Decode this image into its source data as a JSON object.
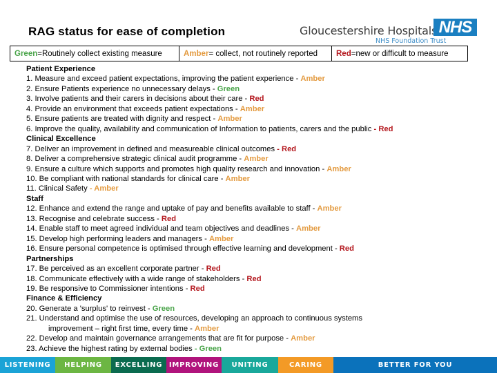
{
  "title": "RAG status for ease of completion",
  "logo": {
    "org_name": "Gloucestershire Hospitals",
    "nhs_mark": "NHS",
    "subtitle": "NHS Foundation Trust"
  },
  "colors": {
    "green": "#4aa44a",
    "amber": "#e39a3f",
    "red": "#b3161c",
    "nhs_blue": "#1a7fc1"
  },
  "legend": [
    {
      "status": "Green",
      "text": " =Routinely collect existing measure"
    },
    {
      "status": "Amber",
      "text": " = collect, not routinely reported"
    },
    {
      "status": "Red",
      "text": " =new or difficult to measure"
    }
  ],
  "sections": [
    {
      "heading": "Patient Experience",
      "items": [
        {
          "text": "1. Measure and exceed patient expectations, improving the patient experience - ",
          "status": "Amber"
        },
        {
          "text": "2. Ensure Patients experience no unnecessary delays - ",
          "status": "Green"
        },
        {
          "text": "3. Involve patients and their carers in decisions about their care - ",
          "status": "Red"
        },
        {
          "text": "4. Provide an environment that exceeds patient expectations - ",
          "status": "Amber"
        },
        {
          "text": "5. Ensure patients are treated with dignity and respect - ",
          "status": "Amber"
        },
        {
          "text": "6. Improve the quality, availability and communication of Information to patients, carers and the public ",
          "status": "- Red"
        }
      ]
    },
    {
      "heading": "Clinical Excellence",
      "items": [
        {
          "text": "7. Deliver an improvement in defined and measureable clinical outcomes ",
          "status": "- Red"
        },
        {
          "text": "8. Deliver a comprehensive strategic clinical audit programme - ",
          "status": "Amber"
        },
        {
          "text": "9. Ensure a culture which supports and promotes high quality research and innovation - ",
          "status": "Amber"
        },
        {
          "text": "10. Be compliant with national standards for clinical care - ",
          "status": "Amber"
        },
        {
          "text": "11. Clinical Safety ",
          "status": "- Amber"
        }
      ]
    },
    {
      "heading": "Staff",
      "items": [
        {
          "text": "12. Enhance and extend the range and uptake of pay and benefits available to staff - ",
          "status": "Amber"
        },
        {
          "text": "13. Recognise and celebrate success - ",
          "status": "Red"
        },
        {
          "text": "14. Enable staff to meet agreed individual and team objectives and deadlines - ",
          "status": "Amber"
        },
        {
          "text": "15. Develop high performing leaders and managers - ",
          "status": "Amber"
        },
        {
          "text": "16. Ensure personal competence is optimised through effective learning and development - ",
          "status": "Red"
        }
      ]
    },
    {
      "heading": "Partnerships",
      "items": [
        {
          "text": "17. Be perceived as an excellent corporate partner - ",
          "status": "Red"
        },
        {
          "text": "18. Communicate effectively with a wide range of stakeholders - ",
          "status": "Red"
        },
        {
          "text": "19. Be responsive to Commissioner intentions - ",
          "status": "Red"
        }
      ]
    },
    {
      "heading": "Finance & Efficiency",
      "items": [
        {
          "text": "20. Generate a 'surplus' to reinvest - ",
          "status": "Green"
        },
        {
          "text": "21. Understand and optimise the use of resources, developing an approach to continuous systems",
          "status": ""
        },
        {
          "text": "improvement – right first time, every time - ",
          "status": "Amber",
          "indent": true
        },
        {
          "text": "22. Develop and maintain governance arrangements that are fit for purpose - ",
          "status": "Amber"
        },
        {
          "text": "23. Achieve the highest rating by external bodies ",
          "status": "- Green"
        }
      ]
    }
  ],
  "footer": [
    "LISTENING",
    "HELPING",
    "EXCELLING",
    "IMPROVING",
    "UNITING",
    "CARING",
    "BETTER FOR YOU"
  ]
}
